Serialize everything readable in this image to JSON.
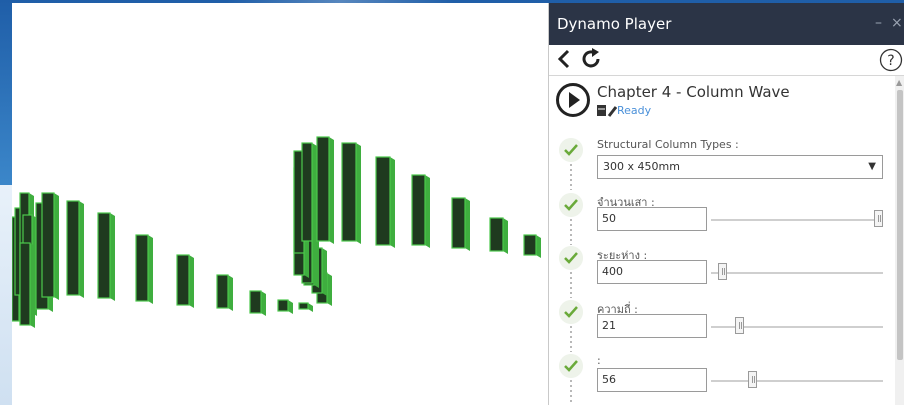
{
  "window": {
    "title": "Dynamo Player",
    "minimize_glyph": "–",
    "close_glyph": "×"
  },
  "toolbar": {
    "back_icon": "chevron-left-icon",
    "refresh_icon": "refresh-icon",
    "help_icon": "help-icon"
  },
  "graph": {
    "name": "Chapter 4 - Column Wave",
    "status": "Ready"
  },
  "inputs": [
    {
      "label": "Structural Column Types :",
      "type": "dropdown",
      "value": "300 x 450mm"
    },
    {
      "label": "จำนวนเสา :",
      "type": "slider",
      "value": "50",
      "level": 1.0
    },
    {
      "label": "ระยะห่าง :",
      "type": "slider",
      "value": "400",
      "level": 0.04
    },
    {
      "label": "ความถี่ :",
      "type": "slider",
      "value": "21",
      "level": 0.15
    },
    {
      "label": ":",
      "type": "slider",
      "value": "56",
      "level": 0.23
    }
  ],
  "colors": {
    "titlebar": "#2b3446",
    "check": "#6aaa3a",
    "status": "#4a90d9",
    "column_face": "#1f3a1f",
    "column_edge": "#4cc94c"
  }
}
